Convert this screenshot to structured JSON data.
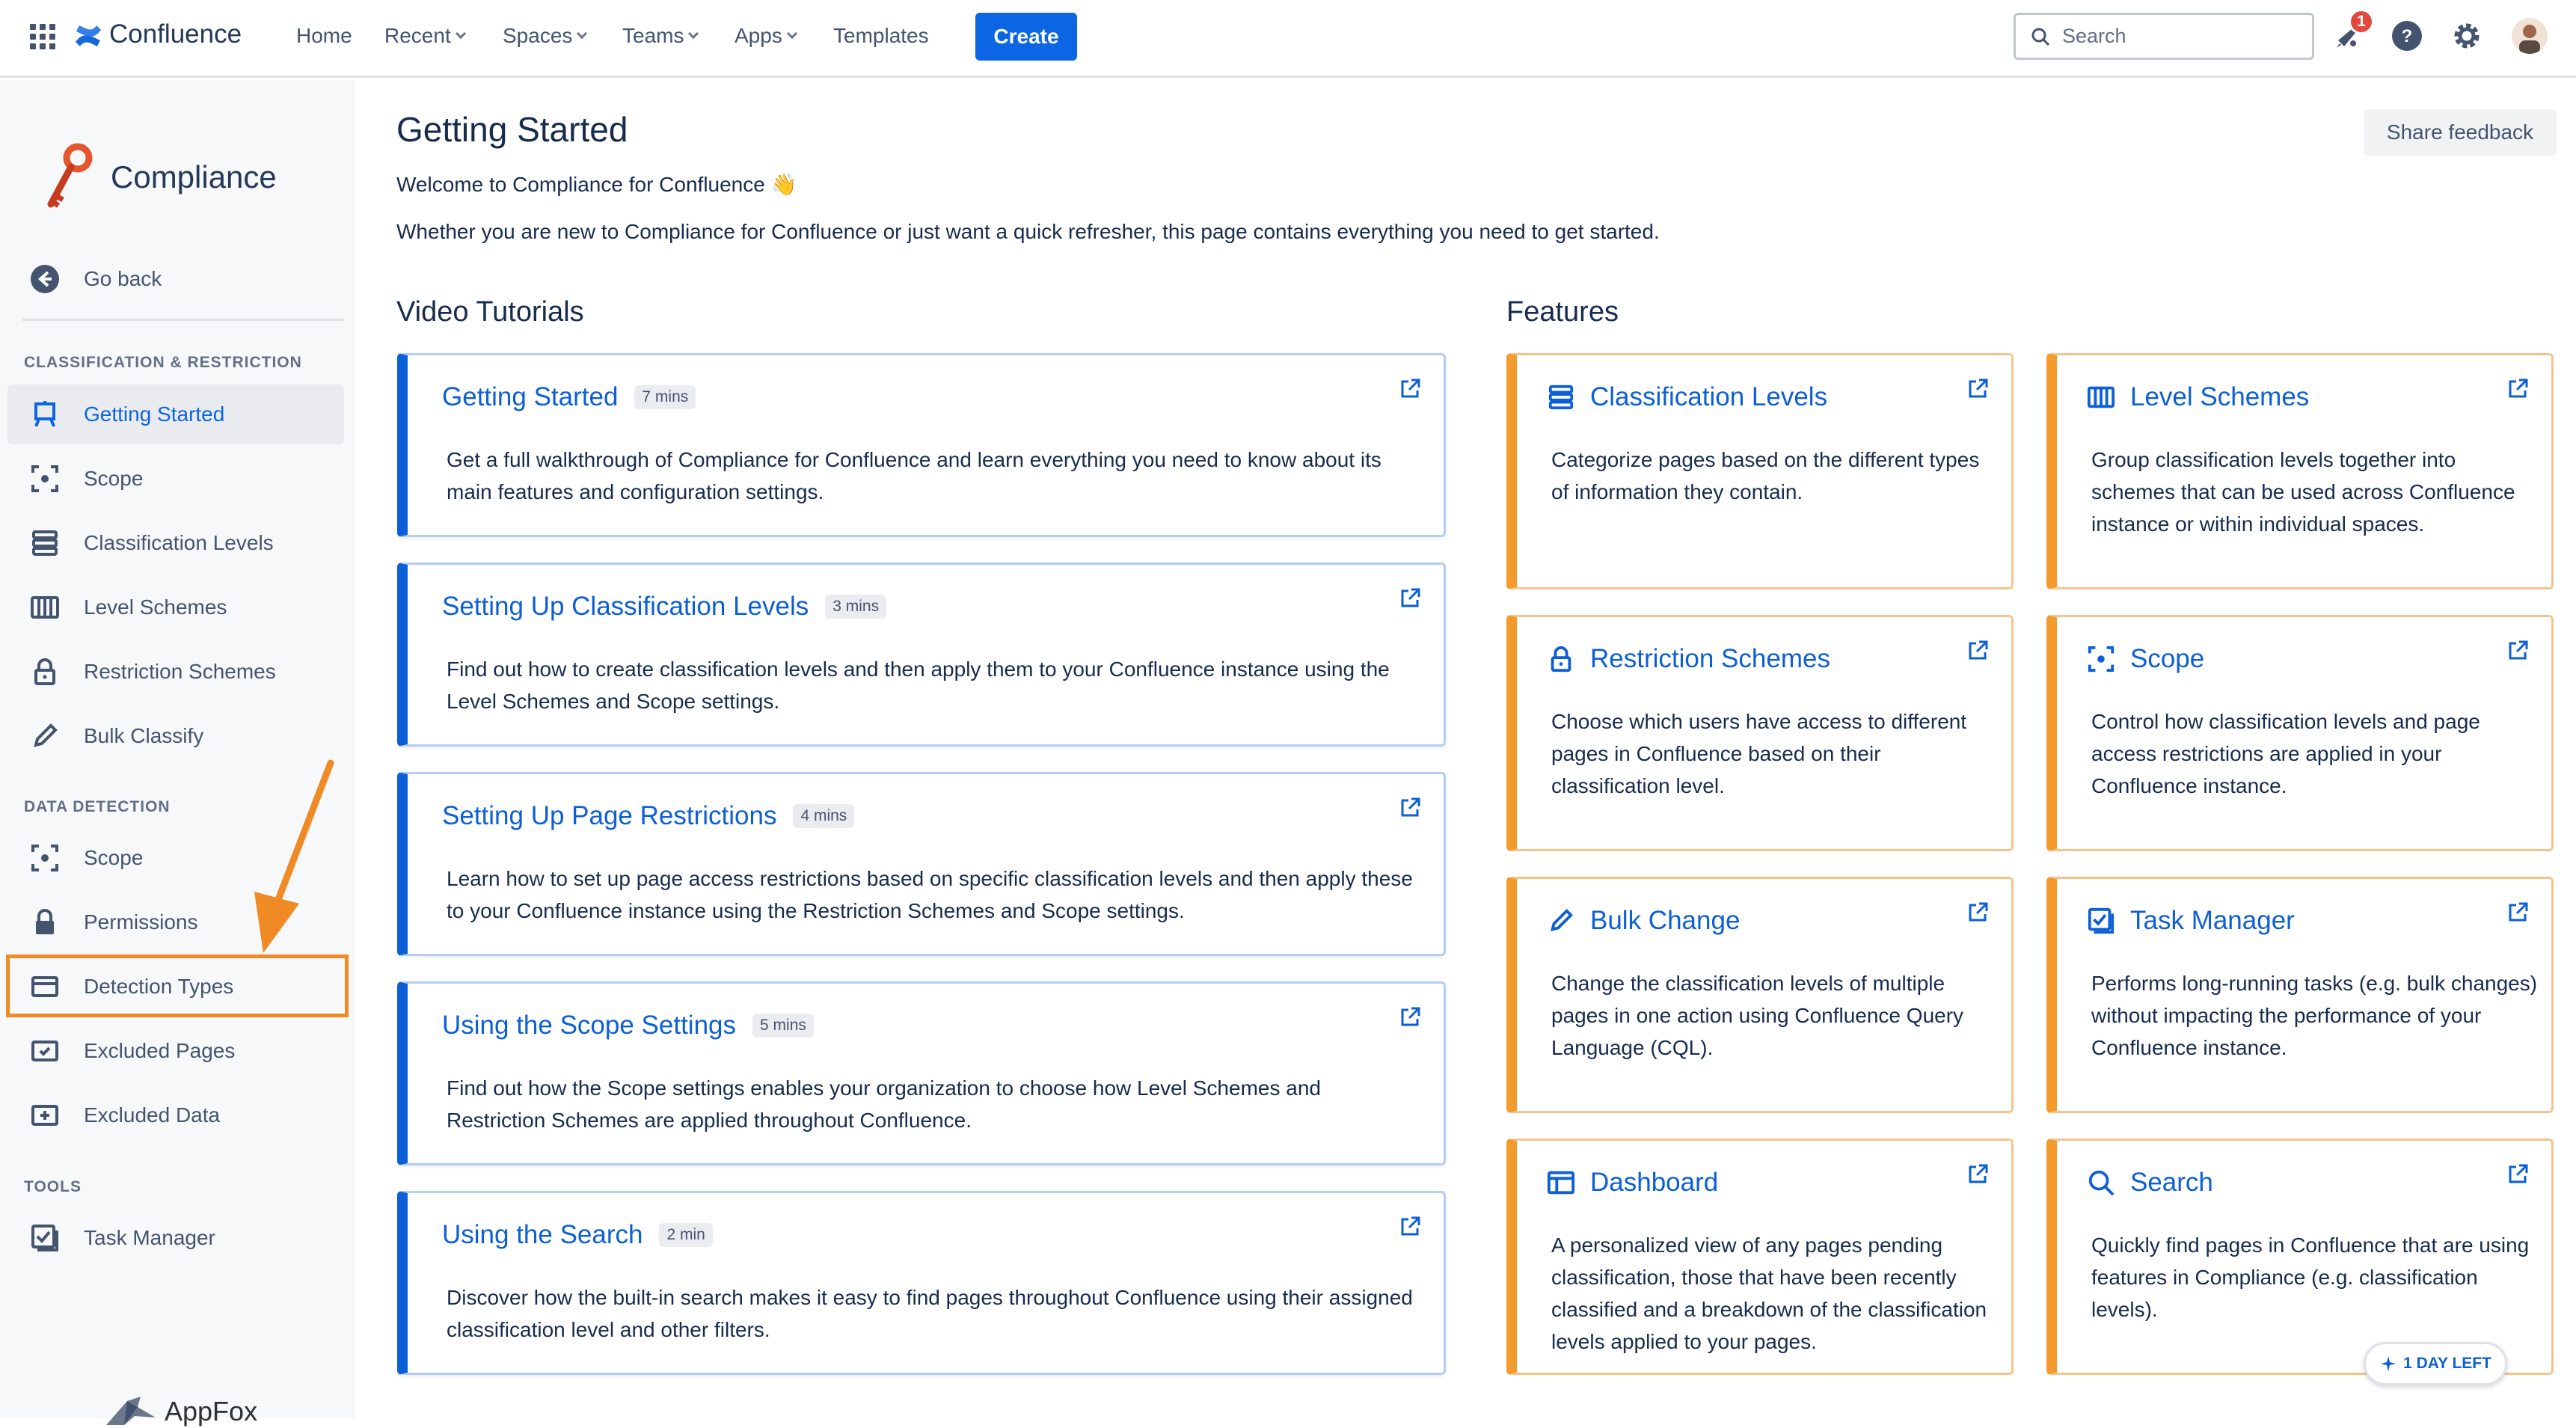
{
  "topbar": {
    "app_name": "Confluence",
    "nav": [
      {
        "label": "Home",
        "has_menu": false
      },
      {
        "label": "Recent",
        "has_menu": true
      },
      {
        "label": "Spaces",
        "has_menu": true
      },
      {
        "label": "Teams",
        "has_menu": true
      },
      {
        "label": "Apps",
        "has_menu": true
      },
      {
        "label": "Templates",
        "has_menu": false
      }
    ],
    "create_label": "Create",
    "search_placeholder": "Search",
    "notification_count": "1",
    "icons": [
      "app-switcher-icon",
      "confluence-logo-icon",
      "search-icon",
      "notifications-icon",
      "help-icon",
      "settings-icon"
    ]
  },
  "sidebar": {
    "app_name": "Compliance",
    "go_back": "Go back",
    "sections": [
      {
        "title": "CLASSIFICATION & RESTRICTION",
        "items": [
          "Getting Started",
          "Scope",
          "Classification Levels",
          "Level Schemes",
          "Restriction Schemes",
          "Bulk Classify"
        ]
      },
      {
        "title": "DATA DETECTION",
        "items": [
          "Scope",
          "Permissions",
          "Detection Types",
          "Excluded Pages",
          "Excluded Data"
        ]
      },
      {
        "title": "TOOLS",
        "items": [
          "Task Manager"
        ]
      }
    ],
    "vendor": "AppFox",
    "active_item": "Getting Started",
    "highlighted_item": "Detection Types"
  },
  "main": {
    "title": "Getting Started",
    "share_feedback": "Share feedback",
    "welcome": "Welcome to Compliance for Confluence 👋",
    "intro": "Whether you are new to Compliance for Confluence or just want a quick refresher, this page contains everything you need to get started.",
    "video_heading": "Video Tutorials",
    "features_heading": "Features",
    "videos": [
      {
        "title": "Getting Started",
        "duration": "7 mins",
        "description": "Get a full walkthrough of Compliance for Confluence and learn everything you need to know about its main features and configuration settings."
      },
      {
        "title": "Setting Up Classification Levels",
        "duration": "3 mins",
        "description": "Find out how to create classification levels and then apply them to your Confluence instance using the Level Schemes and Scope settings."
      },
      {
        "title": "Setting Up Page Restrictions",
        "duration": "4 mins",
        "description": "Learn how to set up page access restrictions based on specific classification levels and then apply these to your Confluence instance using the Restriction Schemes and Scope settings."
      },
      {
        "title": "Using the Scope Settings",
        "duration": "5 mins",
        "description": "Find out how the Scope settings enables your organization to choose how Level Schemes and Restriction Schemes are applied throughout Confluence."
      },
      {
        "title": "Using the Search",
        "duration": "2 min",
        "description": "Discover how the built-in search makes it easy to find pages throughout Confluence using their assigned classification level and other filters."
      }
    ],
    "features": [
      {
        "title": "Classification Levels",
        "icon": "stack-icon",
        "description": "Categorize pages based on the different types of information they contain."
      },
      {
        "title": "Level Schemes",
        "icon": "columns-icon",
        "description": "Group classification levels together into schemes that can be used across Confluence instance or within individual spaces."
      },
      {
        "title": "Restriction Schemes",
        "icon": "lock-icon",
        "description": "Choose which users have access to different pages in Confluence based on their classification level."
      },
      {
        "title": "Scope",
        "icon": "scope-icon",
        "description": "Control how classification levels and page access restrictions are applied in your Confluence instance."
      },
      {
        "title": "Bulk Change",
        "icon": "pencil-icon",
        "description": "Change the classification levels of multiple pages in one action using Confluence Query Language (CQL)."
      },
      {
        "title": "Task Manager",
        "icon": "task-icon",
        "description": "Performs long-running tasks (e.g. bulk changes) without impacting the performance of your Confluence instance."
      },
      {
        "title": "Dashboard",
        "icon": "dashboard-icon",
        "description": "A personalized view of any pages pending classification, those that have been recently classified and a breakdown of the classification levels applied to your pages."
      },
      {
        "title": "Search",
        "icon": "search-icon",
        "description": "Quickly find pages in Confluence that are using features in Compliance (e.g. classification levels)."
      }
    ],
    "trial_badge": "1 DAY LEFT"
  },
  "colors": {
    "brand_blue": "#0c66e4",
    "video_accent": "#0c5fd6",
    "feature_accent": "#f49b2e",
    "highlight": "#f08a24",
    "notification": "#e2483d"
  }
}
